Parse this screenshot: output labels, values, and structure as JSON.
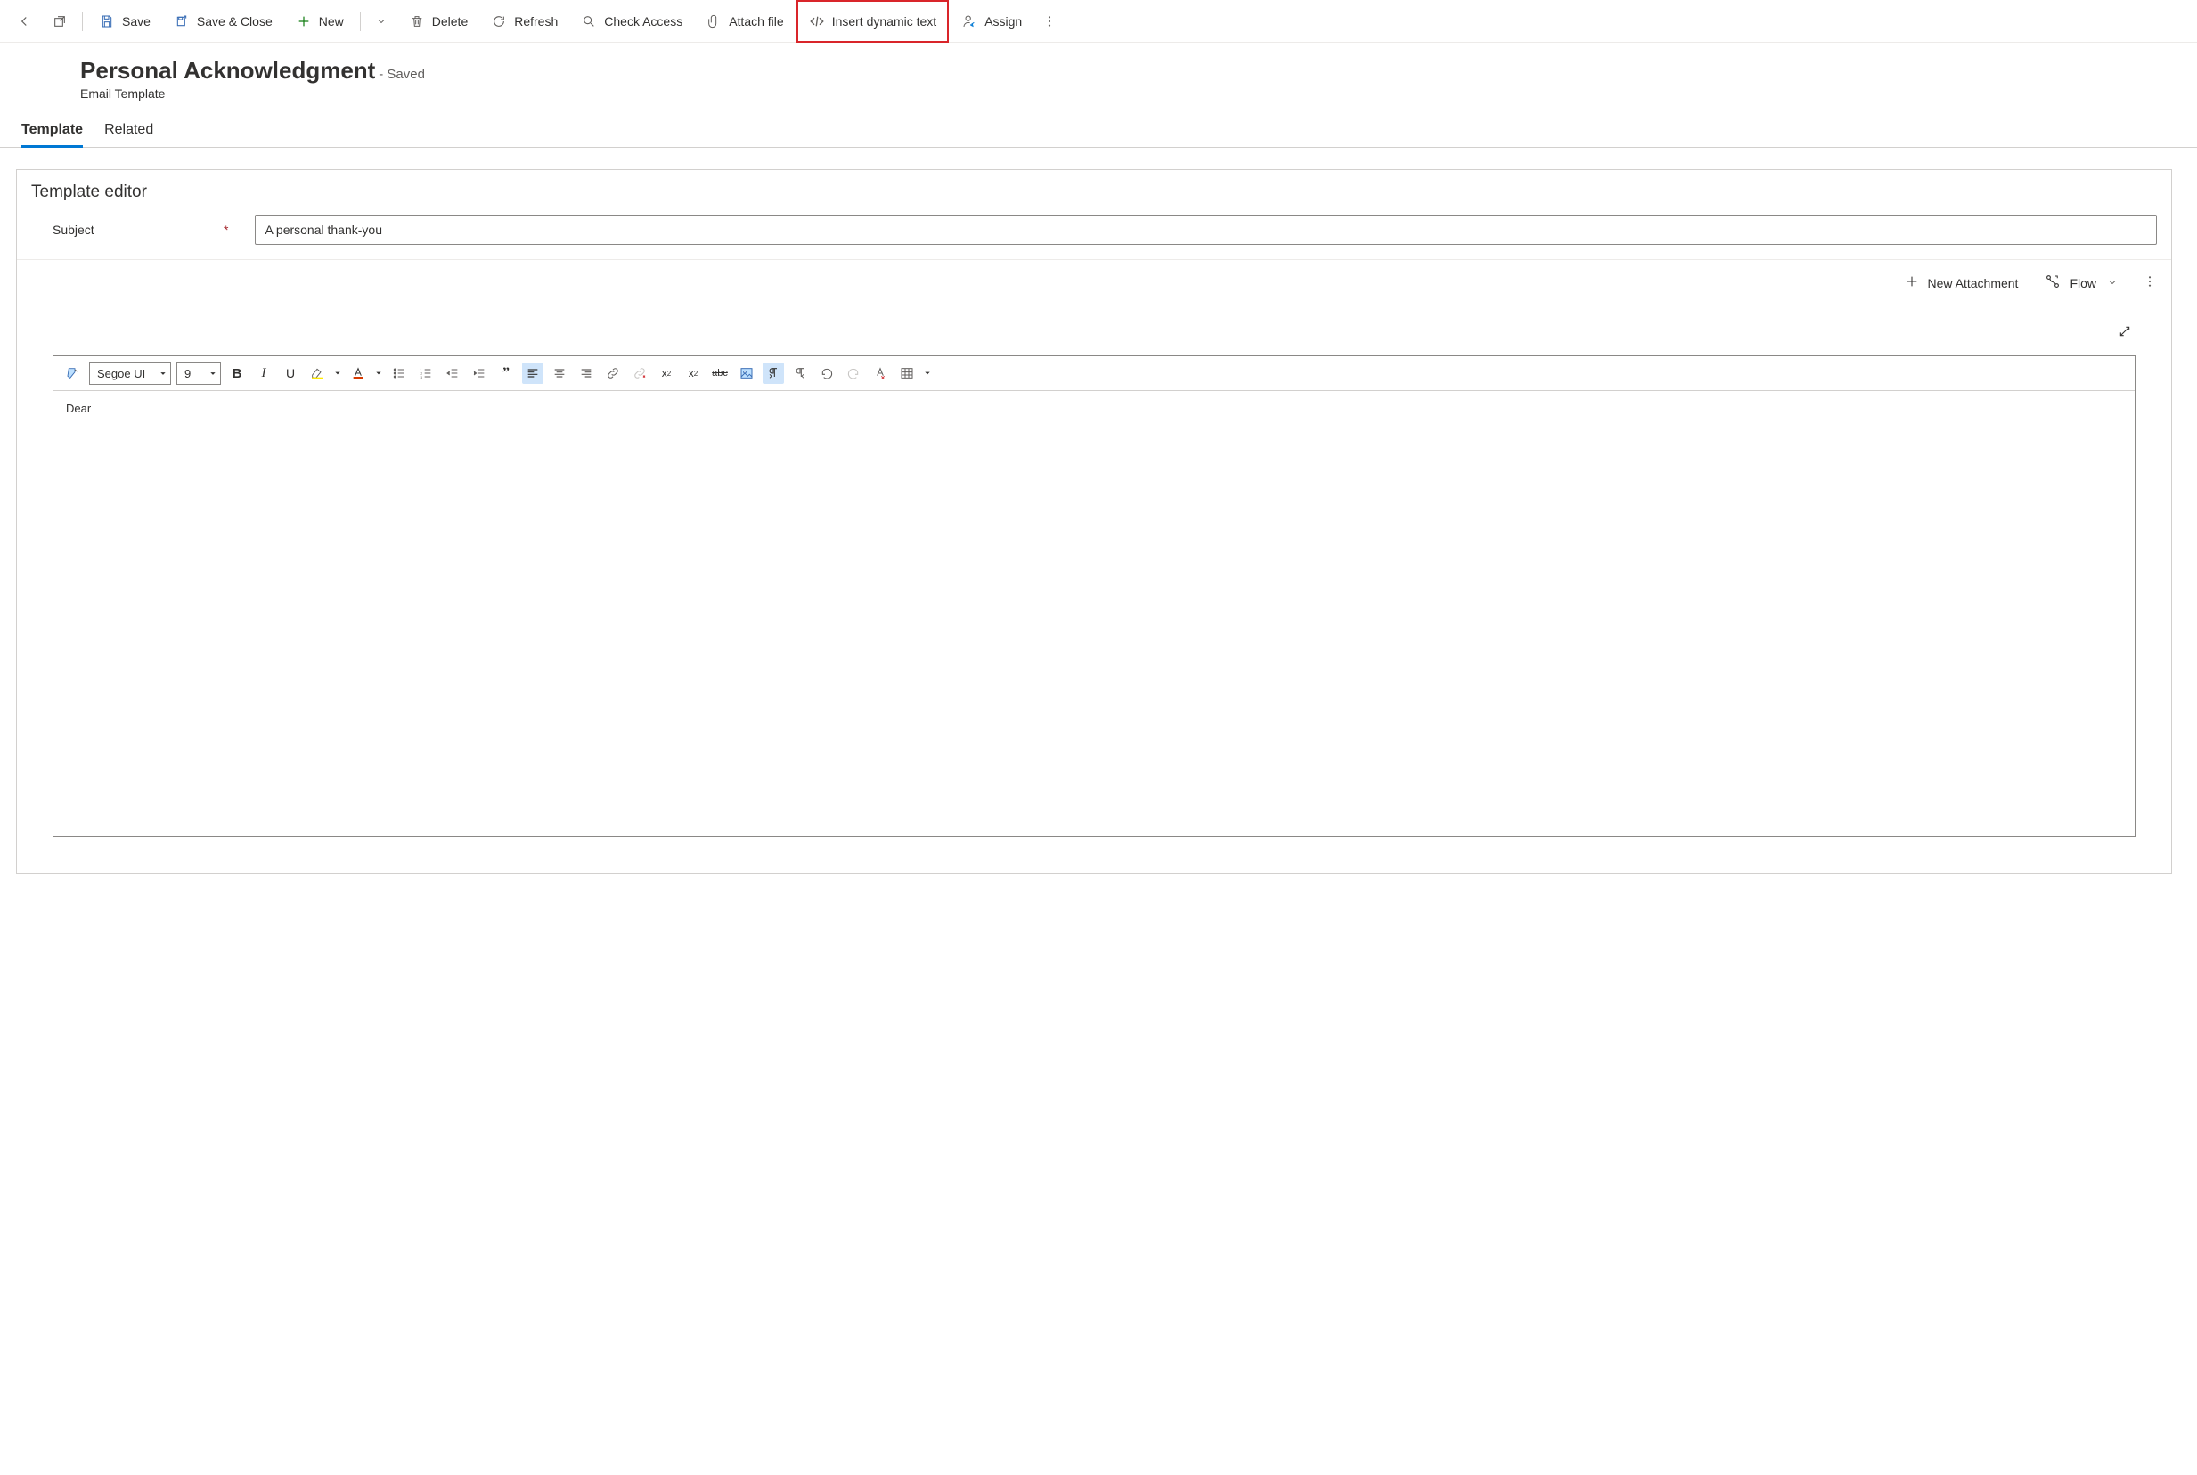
{
  "cmdbar": {
    "save": "Save",
    "save_close": "Save & Close",
    "new": "New",
    "delete": "Delete",
    "refresh": "Refresh",
    "check_access": "Check Access",
    "attach_file": "Attach file",
    "insert_dynamic_text": "Insert dynamic text",
    "assign": "Assign"
  },
  "header": {
    "title": "Personal Acknowledgment",
    "status": "- Saved",
    "subtitle": "Email Template"
  },
  "tabs": {
    "template": "Template",
    "related": "Related"
  },
  "section": {
    "title": "Template editor",
    "subject_label": "Subject",
    "subject_value": "A personal thank-you"
  },
  "subbar": {
    "new_attachment": "New Attachment",
    "flow": "Flow"
  },
  "editor": {
    "font_name": "Segoe UI",
    "font_size": "9",
    "body_text": "Dear"
  }
}
